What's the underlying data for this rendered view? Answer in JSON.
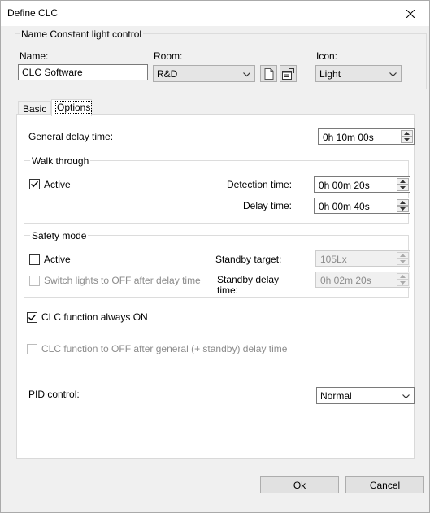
{
  "window": {
    "title": "Define CLC",
    "close_glyph": "✕"
  },
  "name_group": {
    "title": "Name Constant light control",
    "name_label": "Name:",
    "name_value": "CLC Software",
    "room_label": "Room:",
    "room_value": "R&D",
    "icon_label": "Icon:",
    "icon_value": "Light"
  },
  "tabs": [
    {
      "label": "Basic",
      "active": false
    },
    {
      "label": "Options",
      "active": true
    }
  ],
  "options": {
    "general_delay_label": "General delay time:",
    "general_delay_value": "0h 10m 00s",
    "walk_through": {
      "title": "Walk through",
      "active_label": "Active",
      "active_checked": true,
      "detection_label": "Detection time:",
      "detection_value": "0h 00m 20s",
      "delay_label": "Delay time:",
      "delay_value": "0h 00m 40s"
    },
    "safety_mode": {
      "title": "Safety mode",
      "active_label": "Active",
      "active_checked": false,
      "switch_off_label": "Switch lights to OFF after delay time",
      "standby_target_label": "Standby target:",
      "standby_target_value": "105Lx",
      "standby_delay_label_1": "Standby delay",
      "standby_delay_label_2": "time:",
      "standby_delay_value": "0h 02m 20s"
    },
    "clc_always_on_label": "CLC function always ON",
    "clc_always_on_checked": true,
    "clc_off_after_label": "CLC function to OFF after general (+ standby) delay time",
    "pid_label": "PID control:",
    "pid_value": "Normal"
  },
  "buttons": {
    "ok": "Ok",
    "cancel": "Cancel"
  }
}
